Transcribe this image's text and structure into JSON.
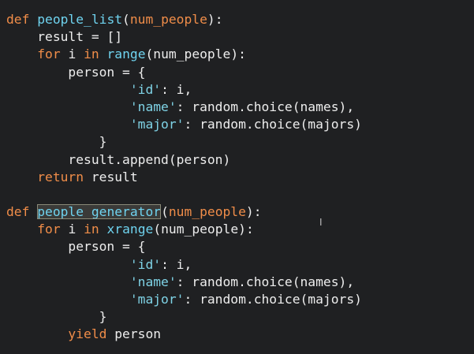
{
  "editor": {
    "cursor_glyph": "I",
    "lines": [
      {
        "indent": "",
        "tokens": [
          {
            "t": "def ",
            "c": "kw"
          },
          {
            "t": "people_list",
            "c": "fn"
          },
          {
            "t": "(",
            "c": "plain"
          },
          {
            "t": "num_people",
            "c": "param"
          },
          {
            "t": "):",
            "c": "plain"
          }
        ]
      },
      {
        "indent": "    ",
        "tokens": [
          {
            "t": "result = []",
            "c": "plain"
          }
        ]
      },
      {
        "indent": "    ",
        "tokens": [
          {
            "t": "for",
            "c": "kw"
          },
          {
            "t": " i ",
            "c": "plain"
          },
          {
            "t": "in",
            "c": "kw"
          },
          {
            "t": " ",
            "c": "plain"
          },
          {
            "t": "range",
            "c": "fn"
          },
          {
            "t": "(num_people):",
            "c": "plain"
          }
        ]
      },
      {
        "indent": "        ",
        "tokens": [
          {
            "t": "person = {",
            "c": "plain"
          }
        ]
      },
      {
        "indent": "                ",
        "tokens": [
          {
            "t": "'id'",
            "c": "str"
          },
          {
            "t": ": i,",
            "c": "plain"
          }
        ]
      },
      {
        "indent": "                ",
        "tokens": [
          {
            "t": "'name'",
            "c": "str"
          },
          {
            "t": ": random.choice(names),",
            "c": "plain"
          }
        ]
      },
      {
        "indent": "                ",
        "tokens": [
          {
            "t": "'major'",
            "c": "str"
          },
          {
            "t": ": random.choice(majors)",
            "c": "plain"
          }
        ]
      },
      {
        "indent": "            ",
        "tokens": [
          {
            "t": "}",
            "c": "plain"
          }
        ]
      },
      {
        "indent": "        ",
        "tokens": [
          {
            "t": "result.append(person)",
            "c": "plain"
          }
        ]
      },
      {
        "indent": "    ",
        "tokens": [
          {
            "t": "return",
            "c": "kw"
          },
          {
            "t": " result",
            "c": "plain"
          }
        ]
      },
      {
        "indent": "",
        "tokens": []
      },
      {
        "indent": "",
        "tokens": [
          {
            "t": "def ",
            "c": "kw"
          },
          {
            "t": "people_generator",
            "c": "fn hl"
          },
          {
            "t": "(",
            "c": "plain"
          },
          {
            "t": "num_people",
            "c": "param"
          },
          {
            "t": "):",
            "c": "plain"
          }
        ]
      },
      {
        "indent": "    ",
        "tokens": [
          {
            "t": "for",
            "c": "kw"
          },
          {
            "t": " i ",
            "c": "plain"
          },
          {
            "t": "in",
            "c": "kw"
          },
          {
            "t": " ",
            "c": "plain"
          },
          {
            "t": "xrange",
            "c": "fn"
          },
          {
            "t": "(num_people):",
            "c": "plain"
          }
        ]
      },
      {
        "indent": "        ",
        "tokens": [
          {
            "t": "person = {",
            "c": "plain"
          }
        ]
      },
      {
        "indent": "                ",
        "tokens": [
          {
            "t": "'id'",
            "c": "str"
          },
          {
            "t": ": i,",
            "c": "plain"
          }
        ]
      },
      {
        "indent": "                ",
        "tokens": [
          {
            "t": "'name'",
            "c": "str"
          },
          {
            "t": ": random.choice(names),",
            "c": "plain"
          }
        ]
      },
      {
        "indent": "                ",
        "tokens": [
          {
            "t": "'major'",
            "c": "str"
          },
          {
            "t": ": random.choice(majors)",
            "c": "plain"
          }
        ]
      },
      {
        "indent": "            ",
        "tokens": [
          {
            "t": "}",
            "c": "plain"
          }
        ]
      },
      {
        "indent": "        ",
        "tokens": [
          {
            "t": "yield",
            "c": "kw"
          },
          {
            "t": " person",
            "c": "plain"
          }
        ]
      }
    ]
  }
}
